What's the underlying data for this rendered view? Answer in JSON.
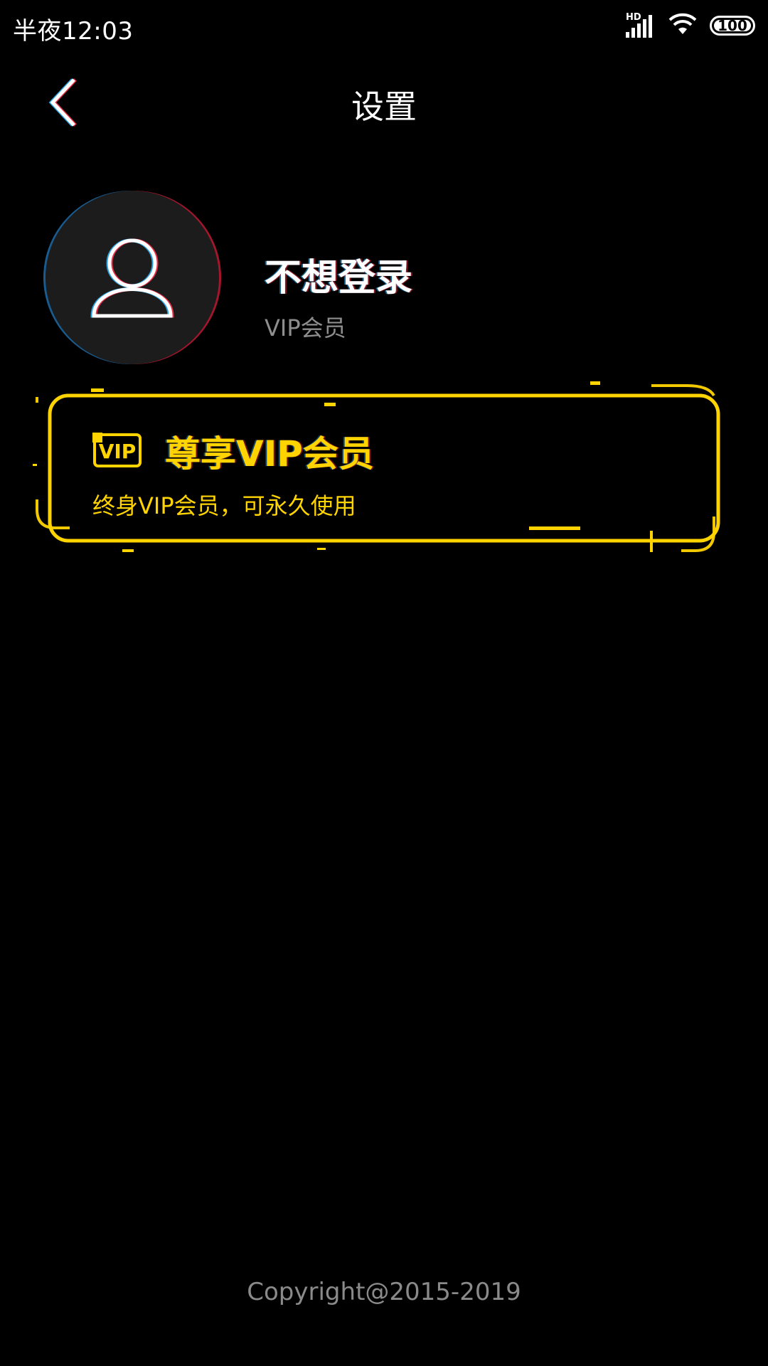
{
  "status_bar": {
    "time": "半夜12:03",
    "network_label": "HD",
    "battery_level": "100",
    "icons": [
      "signal-icon",
      "wifi-icon",
      "battery-icon"
    ]
  },
  "header": {
    "title": "设置",
    "back_icon": "chevron-left-icon"
  },
  "profile": {
    "avatar_icon": "user-icon",
    "username": "不想登录",
    "level": "VIP会员"
  },
  "vip_card": {
    "badge_icon": "vip-badge-icon",
    "badge_text": "VIP",
    "title": "尊享VIP会员",
    "subtitle": "终身VIP会员，可永久使用",
    "accent_color": "#ffd400"
  },
  "footer": {
    "copyright": "Copyright@2015-2019"
  },
  "colors": {
    "background": "#000000",
    "text_primary": "#ffffff",
    "text_secondary": "#8e8e8e",
    "accent": "#ffd400"
  }
}
